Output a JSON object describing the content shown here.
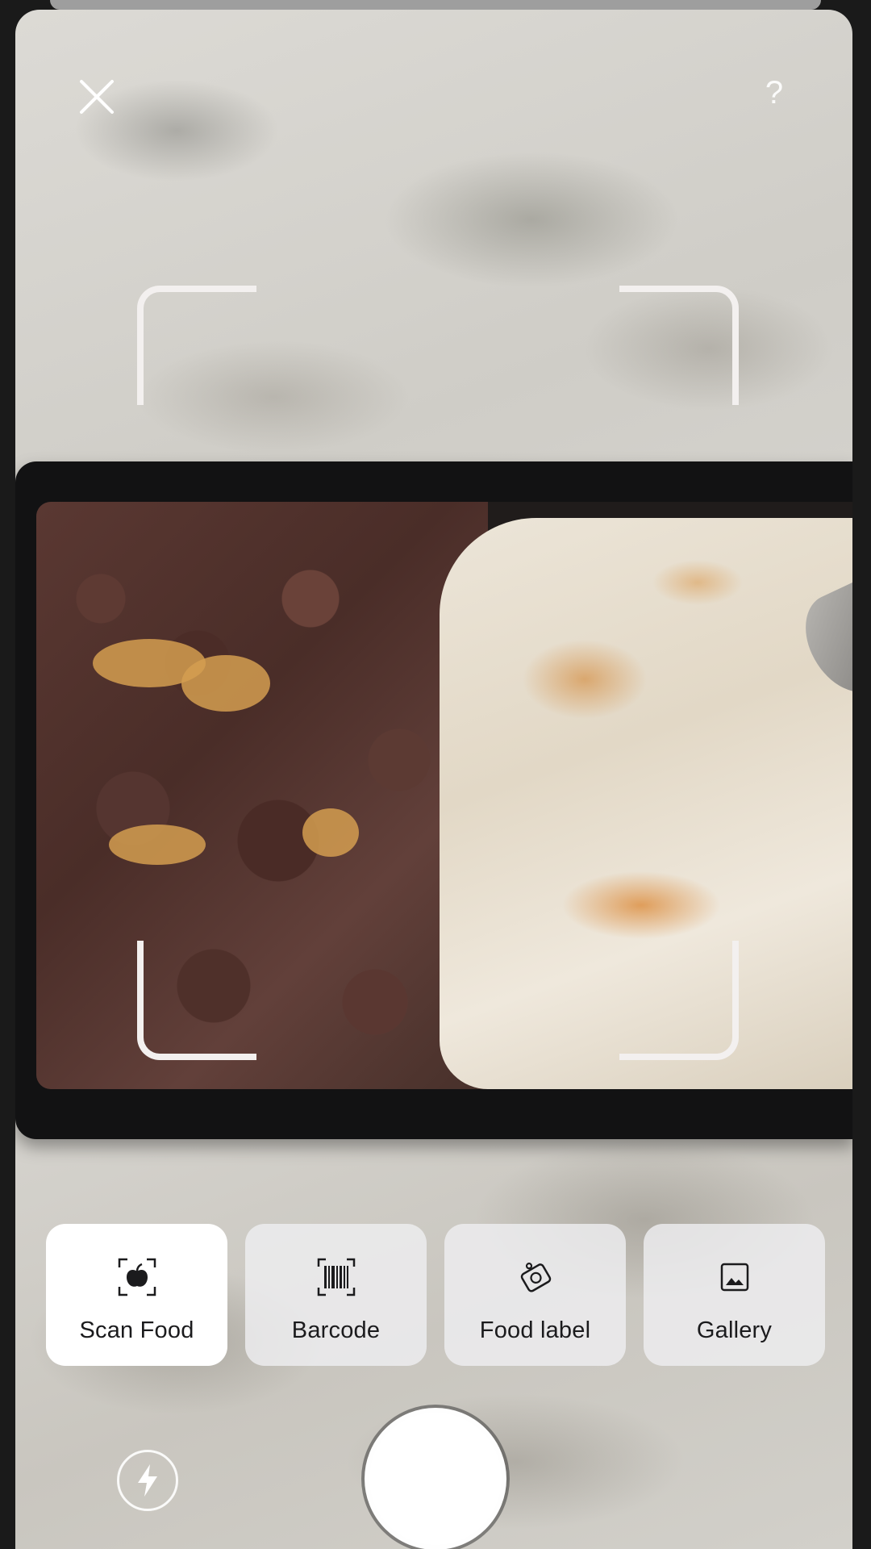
{
  "top_bar": {
    "close_icon": "close-icon",
    "help_label": "?"
  },
  "modes": [
    {
      "label": "Scan Food",
      "icon": "scan-food-icon",
      "active": true
    },
    {
      "label": "Barcode",
      "icon": "barcode-icon",
      "active": false
    },
    {
      "label": "Food label",
      "icon": "food-label-icon",
      "active": false
    },
    {
      "label": "Gallery",
      "icon": "gallery-icon",
      "active": false
    }
  ],
  "bottom_bar": {
    "flash_icon": "flash-icon",
    "shutter": "shutter-button"
  },
  "colors": {
    "button_bg": "#eeeef0",
    "button_active_bg": "#ffffff",
    "label_text": "#1b1b1d",
    "bracket": "#f3f0ef"
  }
}
